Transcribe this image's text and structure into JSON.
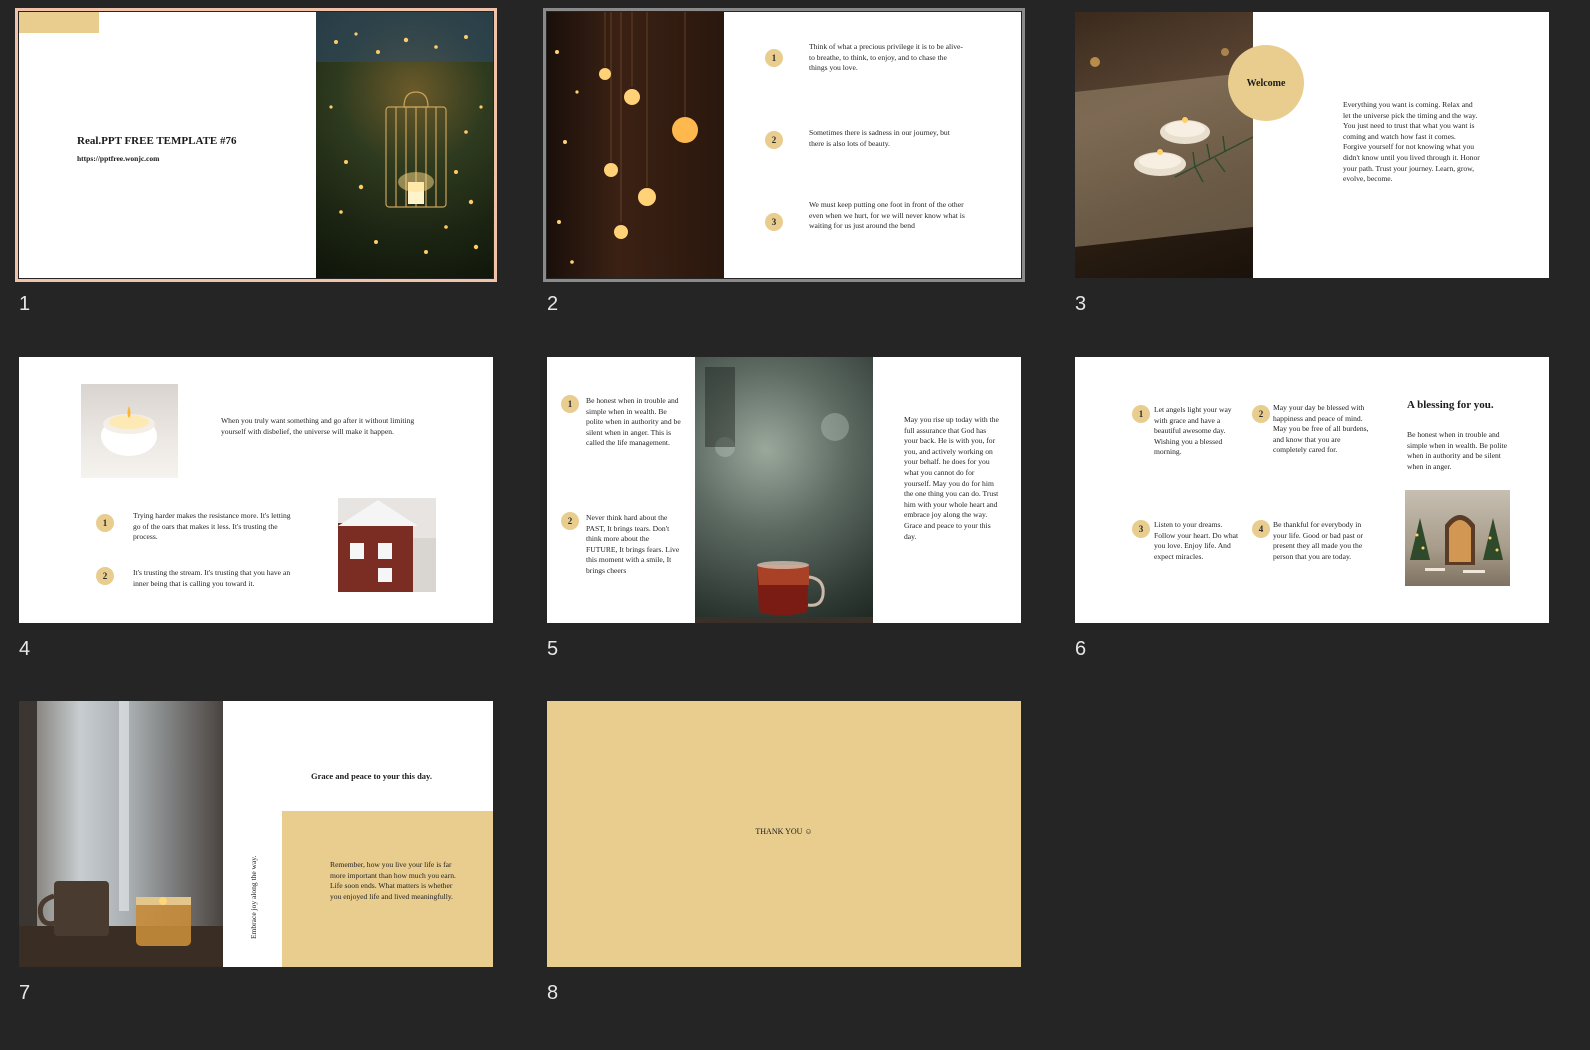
{
  "colors": {
    "background": "#252525",
    "accent": "#e8cd8f",
    "selected_border": "#f0c2a9"
  },
  "slides": [
    {
      "number": "1",
      "title": "Real.PPT FREE TEMPLATE #76",
      "url": "https://pptfree.wonjc.com",
      "image": "birdcage-with-fairy-lights"
    },
    {
      "number": "2",
      "image": "hanging-edison-bulbs",
      "items": [
        {
          "n": "1",
          "text": "Think of what a precious privilege it is to be alive- to breathe, to think, to enjoy, and to chase the things you love."
        },
        {
          "n": "2",
          "text": "Sometimes there is sadness in our journey, but there is also lots of beauty."
        },
        {
          "n": "3",
          "text": "We must keep putting one foot in front of the other even when we hurt, for we will never know what is waiting for us just around the bend"
        }
      ]
    },
    {
      "number": "3",
      "image": "candles-on-open-book",
      "circle_label": "Welcome",
      "body": "Everything you want is coming. Relax and let the universe pick the timing and the way. You just need to trust that what you want is coming and watch how fast it comes. Forgive yourself for not knowing what you didn't know until you lived through it. Honor your path. Trust your journey. Learn, grow, evolve, become."
    },
    {
      "number": "4",
      "image_top": "white-candle",
      "image_side": "snowy-red-house",
      "intro": "When you truly want something and go after it without limiting yourself with disbelief, the universe will make it happen.",
      "items": [
        {
          "n": "1",
          "text": "Trying harder makes the resistance more. It's letting go of the oars that makes it less. It's trusting the process."
        },
        {
          "n": "2",
          "text": "It's trusting the stream. It's trusting that you have an inner being that is calling you toward it."
        }
      ]
    },
    {
      "number": "5",
      "image": "tea-glass-bokeh",
      "items": [
        {
          "n": "1",
          "text": "Be honest when in trouble and simple when in wealth. Be polite when in authority and be silent when in anger. This is called the life management."
        },
        {
          "n": "2",
          "text": "Never think hard about the PAST, It brings tears. Don't think more about the FUTURE, It brings fears. Live this moment with a smile, It brings cheers"
        }
      ],
      "right_text": "May you rise up today with the full assurance that God has your back. He is with you, for you, and actively working on your behalf. he does for you what you cannot do for yourself. May you do for him the one thing you can do. Trust him with your whole heart and embrace joy along the way. Grace and peace to your this day."
    },
    {
      "number": "6",
      "image": "christmas-window-cafe",
      "heading": "A blessing for you.",
      "side_text": "Be honest when in trouble and simple when in wealth. Be polite when in authority and be silent when in anger.",
      "items": [
        {
          "n": "1",
          "text": "Let angels light your way with grace and have a beautiful awesome day. Wishing you a blessed morning."
        },
        {
          "n": "2",
          "text": "May your day be blessed with happiness and peace of mind. May you be free of all burdens, and know that you are completely cared for."
        },
        {
          "n": "3",
          "text": "Listen to your dreams. Follow your heart. Do what you love. Enjoy life. And expect miracles."
        },
        {
          "n": "4",
          "text": "Be thankful for everybody in your life. Good or bad past or present they all made you the person that you are today."
        }
      ]
    },
    {
      "number": "7",
      "image": "candle-and-mug-by-window",
      "heading": "Grace and peace to your this day.",
      "vertical": "Embrace joy along the way.",
      "body": "Remember, how you live your life is far more important than how much you earn. Life soon ends. What matters is whether you enjoyed life and lived meaningfully."
    },
    {
      "number": "8",
      "text": "THANK YOU ☺"
    }
  ]
}
